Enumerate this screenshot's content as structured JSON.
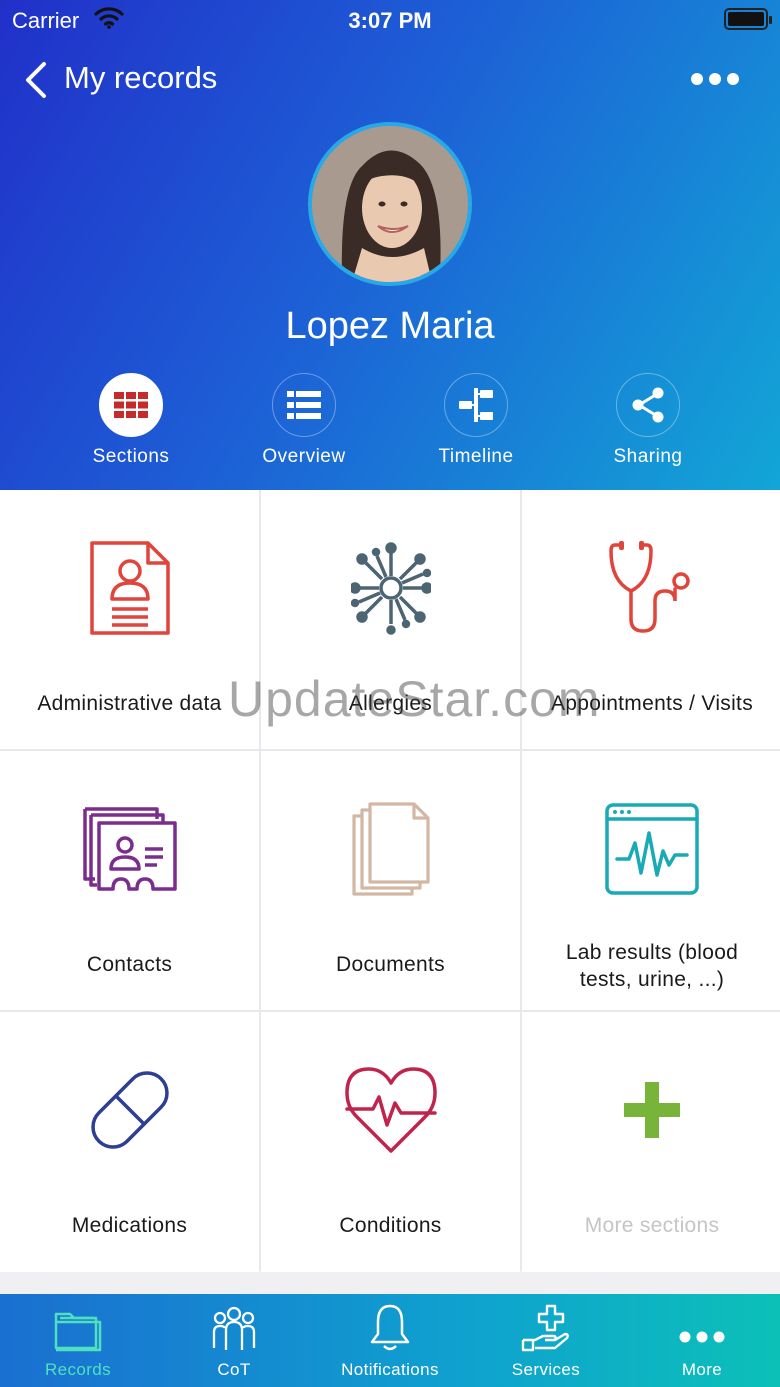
{
  "status_bar": {
    "carrier": "Carrier",
    "time": "3:07 PM"
  },
  "nav": {
    "title": "My records"
  },
  "profile": {
    "name": "Lopez Maria"
  },
  "segments": [
    {
      "label": "Sections",
      "icon": "grid-icon",
      "active": true
    },
    {
      "label": "Overview",
      "icon": "list-icon"
    },
    {
      "label": "Timeline",
      "icon": "timeline-icon"
    },
    {
      "label": "Sharing",
      "icon": "share-icon"
    }
  ],
  "sections": [
    {
      "label": "Administrative data",
      "icon": "id-document-icon",
      "color": "#e0443a"
    },
    {
      "label": "Allergies",
      "icon": "allergen-icon",
      "color": "#4d6473"
    },
    {
      "label": "Appointments / Visits",
      "icon": "stethoscope-icon",
      "color": "#e0443a"
    },
    {
      "label": "Contacts",
      "icon": "contact-cards-icon",
      "color": "#7b2d8e"
    },
    {
      "label": "Documents",
      "icon": "documents-icon",
      "color": "#d2b8a4"
    },
    {
      "label_line1": "Lab results (blood",
      "label_line2": "tests, urine, ...)",
      "icon": "lab-monitor-icon",
      "color": "#19aab5"
    },
    {
      "label": "Medications",
      "icon": "pill-icon",
      "color": "#2e3e94"
    },
    {
      "label": "Conditions",
      "icon": "heart-pulse-icon",
      "color": "#c0244c"
    },
    {
      "label": "More sections",
      "icon": "plus-icon",
      "color": "#78b43a"
    }
  ],
  "watermark": "UpdateStar.com",
  "tabbar": [
    {
      "label": "Records",
      "icon": "folder-icon",
      "active": true
    },
    {
      "label": "CoT",
      "icon": "group-icon"
    },
    {
      "label": "Notifications",
      "icon": "bell-icon"
    },
    {
      "label": "Services",
      "icon": "medical-hand-icon"
    },
    {
      "label": "More",
      "icon": "more-icon"
    }
  ]
}
